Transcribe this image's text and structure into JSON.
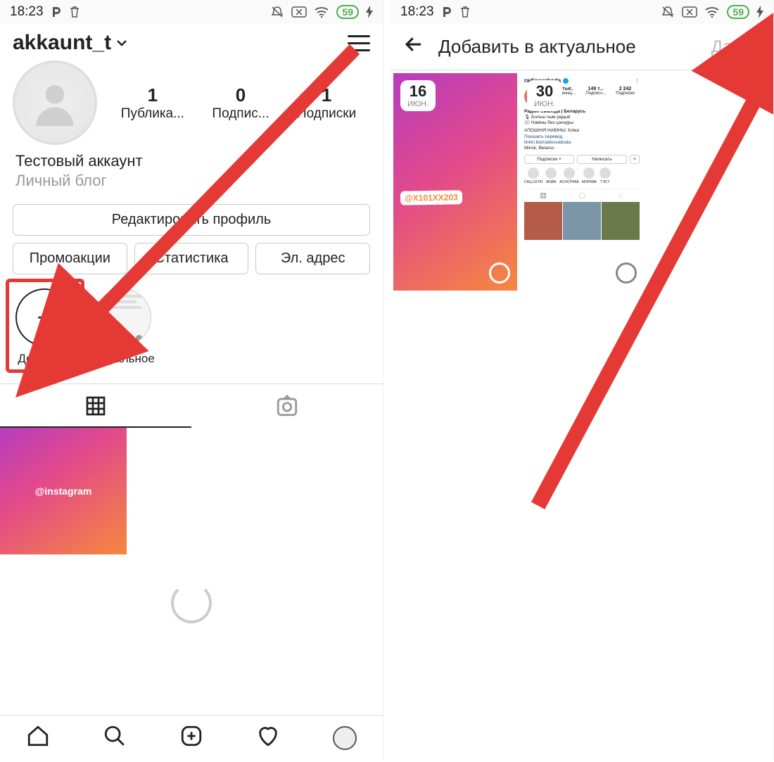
{
  "statusbar": {
    "time": "18:23",
    "battery": "59"
  },
  "left": {
    "username": "akkaunt_t",
    "stats": {
      "posts": {
        "value": "1",
        "label": "Публика..."
      },
      "followers": {
        "value": "0",
        "label": "Подпис..."
      },
      "following": {
        "value": "1",
        "label": "Подписки"
      }
    },
    "bio": {
      "name": "Тестовый аккаунт",
      "category": "Личный блог"
    },
    "buttons": {
      "edit": "Редактировать профиль",
      "promo": "Промоакции",
      "stats": "Статистика",
      "email": "Эл. адрес"
    },
    "highlights": {
      "add": "Добавить",
      "actual": "Актуальное"
    },
    "post_watermark": "@instagram"
  },
  "right": {
    "header": {
      "title": "Добавить в актуальное",
      "next": "Далее"
    },
    "story1": {
      "day": "16",
      "month": "ИЮН.",
      "mention": "@X101XX203"
    },
    "story2": {
      "day": "30",
      "month": "ИЮН.",
      "profile_name": "radiosvaboda",
      "nums": {
        "posts": "11 тыс.",
        "followers": "149 т...",
        "following": "2 242",
        "posts_l": "Публикац...",
        "followers_l": "Подписч...",
        "following_l": "Подписки"
      },
      "bio_title": "Радыё Свабода | Беларусь",
      "bio1": "🎙 Больш чым радыё",
      "bio2": "📰 Навіны без цэнзуры",
      "news_line": "АПОШНІЯ НАВІНЫ: Кліка",
      "translate": "Показать перевод",
      "link": "linkin.bio/radiosvaboda",
      "loc": "Minsk, Belarus",
      "btn_sub": "Подписки ˅",
      "btn_msg": "Написать",
      "hl": [
        "САЦ.СЕТКІ",
        "МОВА",
        "АСНОЎНАE",
        "МОРКВА",
        "ТЭСТ"
      ]
    }
  }
}
